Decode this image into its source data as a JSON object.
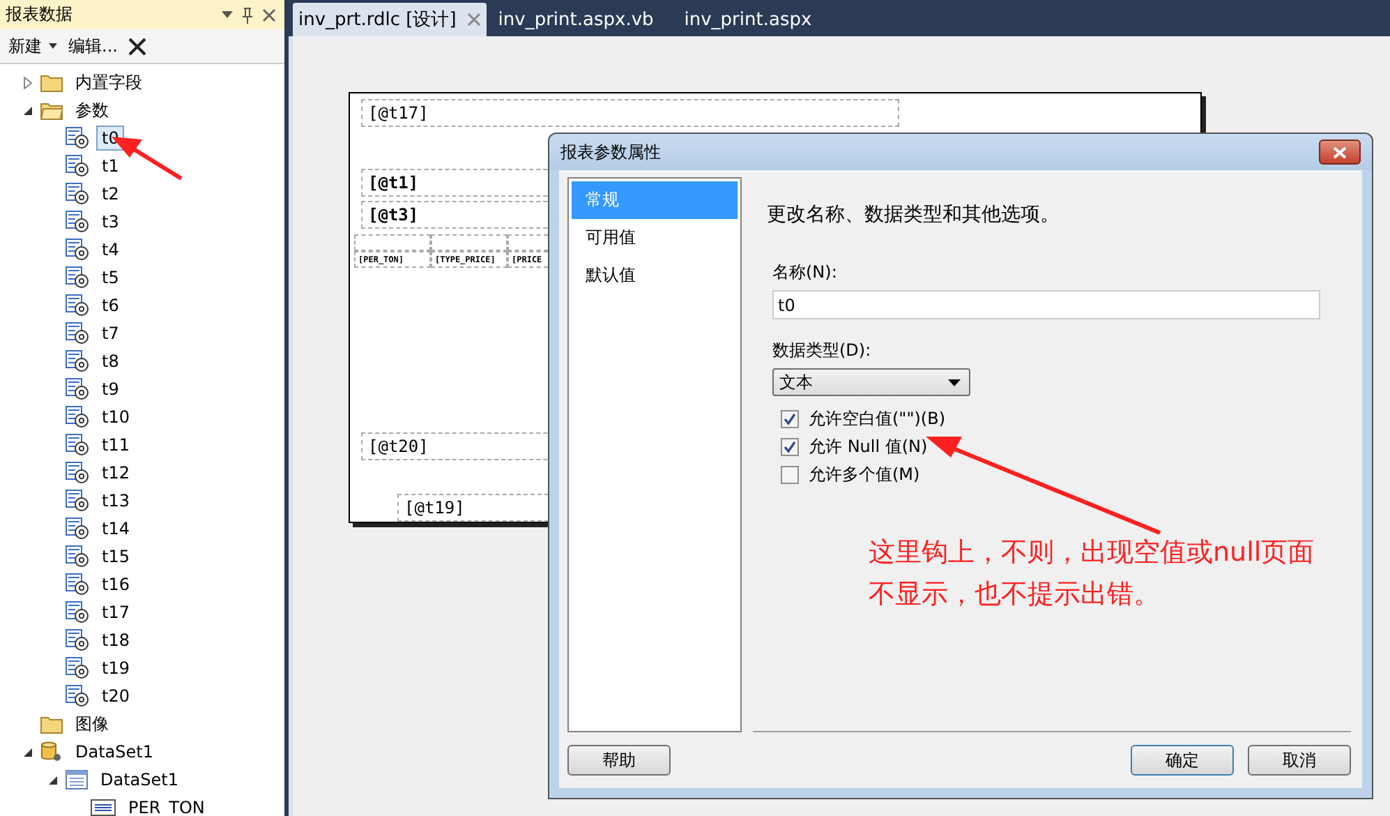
{
  "panel": {
    "title": "报表数据",
    "toolbar": [
      {
        "label": "新建",
        "dropdown": true
      },
      {
        "label": "编辑...",
        "dropdown": false
      }
    ]
  },
  "tree": [
    {
      "label": "内置字段",
      "kind": "folder",
      "expanded": false,
      "selected": false
    },
    {
      "label": "参数",
      "kind": "folder",
      "expanded": true,
      "selected": false,
      "children": [
        {
          "label": "t0",
          "kind": "param",
          "selected": true
        },
        {
          "label": "t1",
          "kind": "param",
          "selected": false
        },
        {
          "label": "t2",
          "kind": "param",
          "selected": false
        },
        {
          "label": "t3",
          "kind": "param",
          "selected": false
        },
        {
          "label": "t4",
          "kind": "param",
          "selected": false
        },
        {
          "label": "t5",
          "kind": "param",
          "selected": false
        },
        {
          "label": "t6",
          "kind": "param",
          "selected": false
        },
        {
          "label": "t7",
          "kind": "param",
          "selected": false
        },
        {
          "label": "t8",
          "kind": "param",
          "selected": false
        },
        {
          "label": "t9",
          "kind": "param",
          "selected": false
        },
        {
          "label": "t10",
          "kind": "param",
          "selected": false
        },
        {
          "label": "t11",
          "kind": "param",
          "selected": false
        },
        {
          "label": "t12",
          "kind": "param",
          "selected": false
        },
        {
          "label": "t13",
          "kind": "param",
          "selected": false
        },
        {
          "label": "t14",
          "kind": "param",
          "selected": false
        },
        {
          "label": "t15",
          "kind": "param",
          "selected": false
        },
        {
          "label": "t16",
          "kind": "param",
          "selected": false
        },
        {
          "label": "t17",
          "kind": "param",
          "selected": false
        },
        {
          "label": "t18",
          "kind": "param",
          "selected": false
        },
        {
          "label": "t19",
          "kind": "param",
          "selected": false
        },
        {
          "label": "t20",
          "kind": "param",
          "selected": false
        }
      ]
    },
    {
      "label": "图像",
      "kind": "folder",
      "selected": false
    },
    {
      "label": "DataSet1",
      "kind": "datasource",
      "expanded": true,
      "selected": false,
      "children": [
        {
          "label": "DataSet1",
          "kind": "dataset",
          "expanded": true,
          "selected": false,
          "children": [
            {
              "label": "PER_TON",
              "kind": "field",
              "selected": false
            }
          ]
        }
      ]
    }
  ],
  "tabs": [
    {
      "label": "inv_prt.rdlc [设计]",
      "selected": true,
      "closable": true
    },
    {
      "label": "inv_print.aspx.vb",
      "selected": false,
      "closable": false
    },
    {
      "label": "inv_print.aspx",
      "selected": false,
      "closable": false
    }
  ],
  "report": {
    "header": "[@t17]",
    "fields": [
      "[@t1]",
      "[@t3]"
    ],
    "table_cells": [
      "[PER_TON]",
      "[TYPE_PRICE]",
      "[PRICE"
    ],
    "footers": [
      "[@t20]",
      "[@t19]"
    ]
  },
  "dialog": {
    "title": "报表参数属性",
    "nav": [
      {
        "label": "常规",
        "selected": true
      },
      {
        "label": "可用值",
        "selected": false
      },
      {
        "label": "默认值",
        "selected": false
      }
    ],
    "heading": "更改名称、数据类型和其他选项。",
    "name_label": "名称(N):",
    "name_value": "t0",
    "type_label": "数据类型(D):",
    "type_value": "文本",
    "options": [
      {
        "label": "允许空白值(\"\")(B)",
        "checked": true
      },
      {
        "label": "允许 Null 值(N)",
        "checked": true
      },
      {
        "label": "允许多个值(M)",
        "checked": false
      }
    ],
    "buttons": [
      {
        "label": "帮助",
        "default": false
      },
      {
        "label": "确定",
        "default": true
      },
      {
        "label": "取消",
        "default": false
      }
    ]
  },
  "annotation": {
    "lines": [
      "这里钩上，不则，出现空值或null页面",
      "不显示，也不提示出错。"
    ]
  }
}
